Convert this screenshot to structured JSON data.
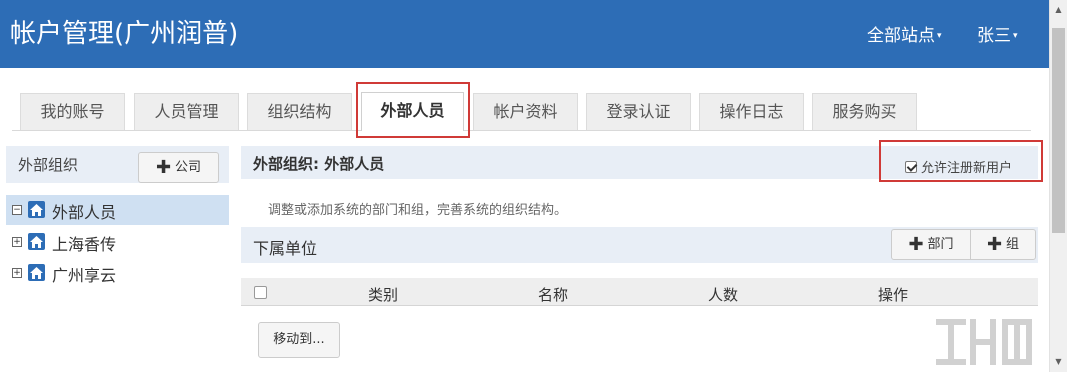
{
  "header": {
    "title": "帐户管理(广州润普)",
    "site_menu": "全部站点",
    "user_menu": "张三"
  },
  "tabs": [
    {
      "label": "我的账号"
    },
    {
      "label": "人员管理"
    },
    {
      "label": "组织结构"
    },
    {
      "label": "外部人员",
      "active": true
    },
    {
      "label": "帐户资料"
    },
    {
      "label": "登录认证"
    },
    {
      "label": "操作日志"
    },
    {
      "label": "服务购买"
    }
  ],
  "left_panel": {
    "title": "外部组织",
    "add_company_button": "公司",
    "tree": [
      {
        "label": "外部人员",
        "toggle": "⊟",
        "selected": true
      },
      {
        "label": "上海香传",
        "toggle": "⊞"
      },
      {
        "label": "广州享云",
        "toggle": "⊞"
      }
    ]
  },
  "main": {
    "section_title": "外部组织: 外部人员",
    "allow_register": {
      "label": "允许注册新用户",
      "checked": true
    },
    "description": "调整或添加系统的部门和组，完善系统的组织结构。",
    "sub_title": "下属单位",
    "add_department_button": "部门",
    "add_group_button": "组",
    "table_columns": [
      "类别",
      "名称",
      "人数",
      "操作"
    ],
    "move_button": "移动到..."
  },
  "colors": {
    "header_bg": "#2d6db6",
    "panel_bg": "#e8eef6",
    "highlight": "#d03a37",
    "selected_row": "#cfe0f2"
  }
}
